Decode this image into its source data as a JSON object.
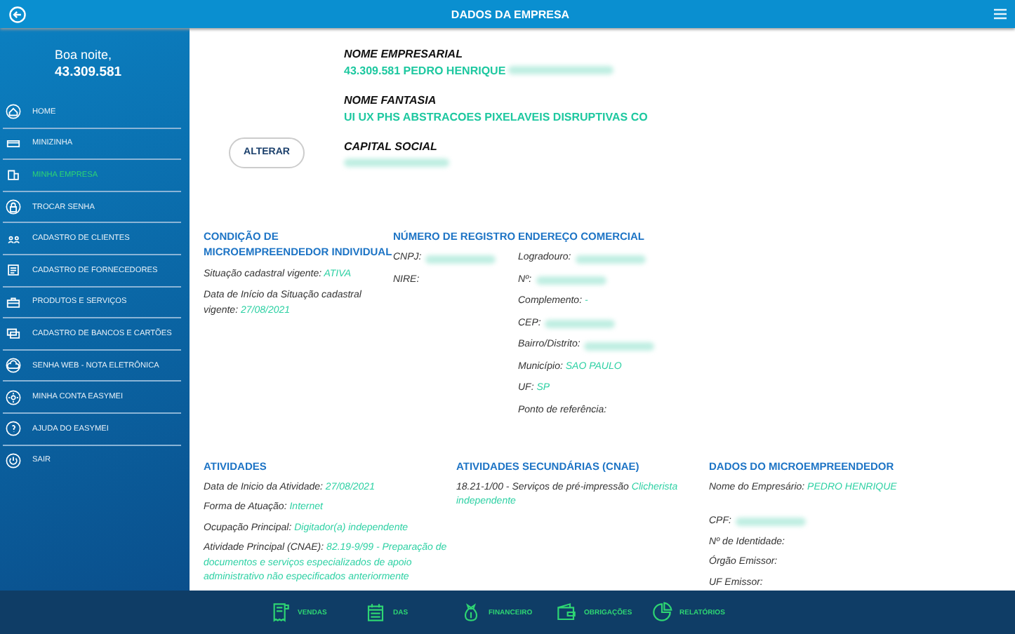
{
  "header": {
    "title": "DADOS DA EMPRESA"
  },
  "sidebar": {
    "greeting": "Boa noite,",
    "user": "43.309.581",
    "items": [
      {
        "label": "HOME",
        "selected": false
      },
      {
        "label": "MINIZINHA",
        "selected": false
      },
      {
        "label": "MINHA EMPRESA",
        "selected": true
      },
      {
        "label": "TROCAR SENHA",
        "selected": false
      },
      {
        "label": "CADASTRO DE CLIENTES",
        "selected": false
      },
      {
        "label": "CADASTRO DE FORNECEDORES",
        "selected": false
      },
      {
        "label": "PRODUTOS E SERVIÇOS",
        "selected": false
      },
      {
        "label": "CADASTRO DE BANCOS E CARTÕES",
        "selected": false
      },
      {
        "label": "SENHA WEB - NOTA ELETRÔNICA",
        "selected": false
      },
      {
        "label": "MINHA CONTA EASYMEI",
        "selected": false
      },
      {
        "label": "AJUDA DO EASYMEI",
        "selected": false
      },
      {
        "label": "SAIR",
        "selected": false
      }
    ]
  },
  "company": {
    "button": "ALTERAR",
    "fields": [
      {
        "label": "NOME EMPRESARIAL",
        "value": "43.309.581 PEDRO HENRIQUE",
        "redacted": true
      },
      {
        "label": "NOME FANTASIA",
        "value": "UI UX PHS ABSTRACOES PIXELAVEIS DISRUPTIVAS CO",
        "redacted": false
      },
      {
        "label": "CAPITAL SOCIAL",
        "redacted": true
      }
    ]
  },
  "sections": [
    [
      {
        "title": "CONDIÇÃO DE MICROEMPREENDEDOR INDIVIDUAL",
        "lines": [
          {
            "label": "Situação cadastral vigente:",
            "value": "ATIVA",
            "redacted": false
          },
          {
            "label": "Data de Início da Situação cadastral vigente:",
            "value": "27/08/2021",
            "redacted": false
          }
        ]
      },
      {
        "title": "NÚMERO DE REGISTRO",
        "lines": [
          {
            "label": "CNPJ:",
            "redacted": true
          },
          {
            "label": "NIRE:",
            "redacted": false
          }
        ]
      },
      {
        "title": "ENDEREÇO COMERCIAL",
        "lines": [
          {
            "label": "Logradouro:",
            "redacted": true
          },
          {
            "label": "Nº:",
            "redacted": true
          },
          {
            "label": "Complemento:",
            "value": "-",
            "redacted": false
          },
          {
            "label": "CEP:",
            "redacted": true
          },
          {
            "label": "Bairro/Distrito:",
            "redacted": true
          },
          {
            "label": "Município:",
            "value": "SAO PAULO",
            "redacted": false
          },
          {
            "label": "UF:",
            "value": "SP",
            "redacted": false
          },
          {
            "label": "Ponto de referência:",
            "redacted": false
          }
        ]
      }
    ],
    [
      {
        "title": "ATIVIDADES",
        "lines": [
          {
            "label": "Data de Inicio da Atividade:",
            "value": "27/08/2021",
            "redacted": false
          },
          {
            "label": "Forma de Atuação:",
            "value": "Internet",
            "redacted": false
          },
          {
            "label": "Ocupação Principal:",
            "value": "Digitador(a) independente",
            "redacted": false
          },
          {
            "label": "Atividade Principal (CNAE):",
            "value": "82.19-9/99 - Preparação de documentos e serviços especializados de apoio administrativo não especificados anteriormente",
            "redacted": false
          }
        ]
      },
      {
        "title": "ATIVIDADES SECUNDÁRIAS (CNAE)",
        "lines": [
          {
            "label": "18.21-1/00 - Serviços de pré-impressão",
            "value": "Clicherista independente",
            "redacted": false
          }
        ]
      },
      {
        "title": "DADOS DO MICROEMPREENDEDOR",
        "lines": [
          {
            "label": "Nome do Empresário:",
            "value": "PEDRO HENRIQUE",
            "redacted": false
          },
          {
            "label": "CPF:",
            "redacted": true
          },
          {
            "label": "Nº de Identidade:",
            "redacted": false
          },
          {
            "label": "Órgão Emissor:",
            "redacted": false
          },
          {
            "label": "UF Emissor:",
            "redacted": false
          }
        ]
      }
    ]
  ],
  "bottom_nav": [
    "VENDAS",
    "DAS",
    "FINANCEIRO",
    "OBRIGAÇÕES",
    "RELATÓRIOS"
  ]
}
